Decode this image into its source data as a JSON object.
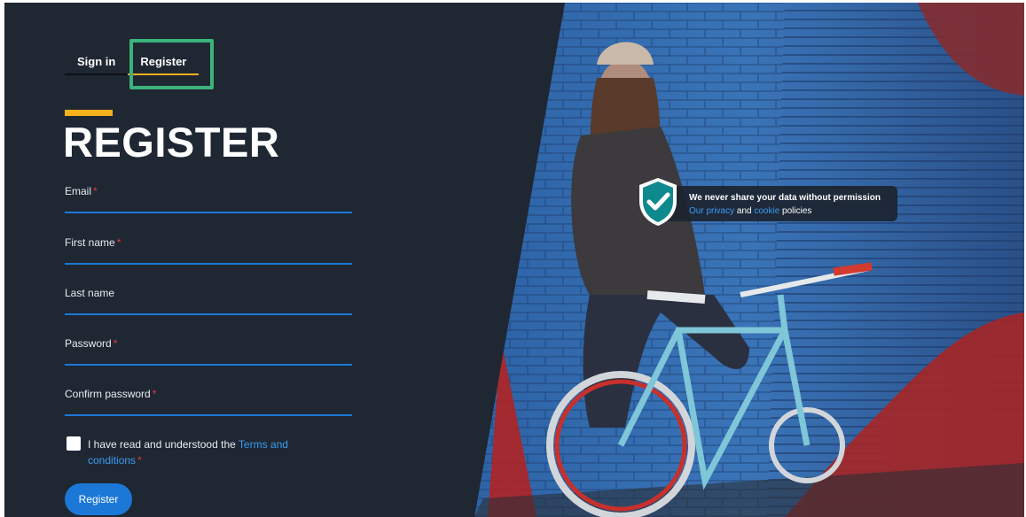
{
  "tabs": {
    "sign_in": "Sign in",
    "register": "Register"
  },
  "heading": "REGISTER",
  "fields": {
    "email": {
      "label": "Email",
      "required": "*"
    },
    "first_name": {
      "label": "First name",
      "required": "*"
    },
    "last_name": {
      "label": "Last name"
    },
    "password": {
      "label": "Password",
      "required": "*"
    },
    "confirm_password": {
      "label": "Confirm password",
      "required": "*"
    }
  },
  "terms": {
    "text_before": "I have read and understood the ",
    "link": "Terms and conditions",
    "required": "*"
  },
  "register_button": "Register",
  "privacy": {
    "headline": "We never share your data without permission",
    "link_privacy": "Our privacy",
    "and": " and ",
    "link_cookie": "cookie",
    "policies": " policies"
  },
  "colors": {
    "panel_bg": "#1f2733",
    "accent_yellow": "#f5b21c",
    "accent_blue": "#1b78d6",
    "link_blue": "#3b9bf0",
    "required_red": "#e33b3b",
    "focus_green": "#3bb37a",
    "shield_teal": "#0e8a8e"
  },
  "icons": {
    "shield": "shield-check-icon",
    "checkbox": "checkbox-unchecked"
  }
}
